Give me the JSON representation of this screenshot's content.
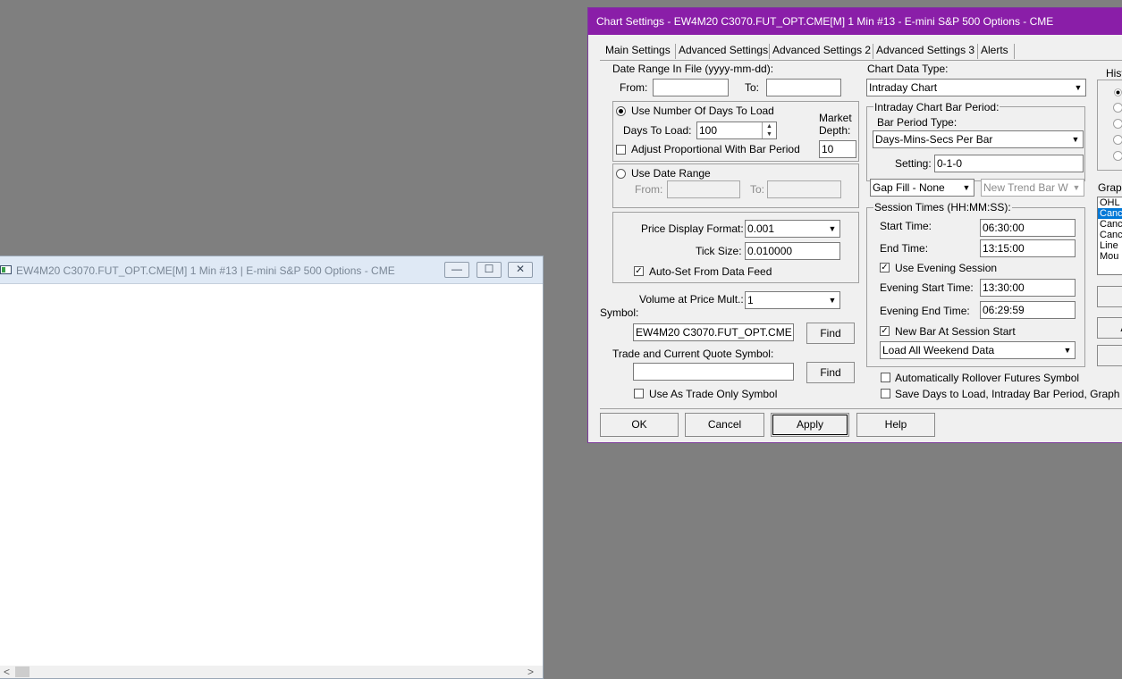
{
  "chart_window": {
    "title": "EW4M20 C3070.FUT_OPT.CME[M]  1 Min  #13 | E-mini S&P 500 Options - CME",
    "minimize": "—",
    "restore": "☐",
    "close": "✕",
    "scroll_left": "<",
    "scroll_right": ">"
  },
  "dialog": {
    "title": "Chart Settings - EW4M20 C3070.FUT_OPT.CME[M]  1 Min  #13 - E-mini S&P 500 Options - CME",
    "tabs": [
      "Main Settings",
      "Advanced Settings",
      "Advanced Settings 2",
      "Advanced Settings 3",
      "Alerts"
    ],
    "date_range_file": {
      "label": "Date Range In File (yyyy-mm-dd):",
      "from_label": "From:",
      "to_label": "To:",
      "from_value": "",
      "to_value": ""
    },
    "days_group": {
      "use_days_label": "Use Number Of Days To Load",
      "days_label": "Days To Load:",
      "days_value": "100",
      "adjust_label": "Adjust Proportional With Bar Period",
      "market_label_1": "Market",
      "market_label_2": "Depth:",
      "market_value": "10"
    },
    "date_range_group": {
      "use_label": "Use Date Range",
      "from_label": "From:",
      "to_label": "To:"
    },
    "price_group": {
      "price_format_label": "Price Display Format:",
      "price_format_value": "0.001",
      "tick_size_label": "Tick Size:",
      "tick_size_value": "0.010000",
      "auto_set_label": "Auto-Set From Data Feed"
    },
    "volume_label": "Volume at Price Mult.:",
    "volume_value": "1",
    "symbol_label": "Symbol:",
    "symbol_value": "EW4M20 C3070.FUT_OPT.CME",
    "find_label": "Find",
    "trade_symbol_label": "Trade and Current Quote Symbol:",
    "trade_symbol_value": "",
    "trade_only_label": "Use As Trade Only Symbol",
    "chart_data_type_label": "Chart Data Type:",
    "chart_data_type_value": "Intraday Chart",
    "bar_period": {
      "group_label": "Intraday Chart Bar Period:",
      "type_label": "Bar Period Type:",
      "type_value": "Days-Mins-Secs Per Bar",
      "setting_label": "Setting:",
      "setting_value": "0-1-0"
    },
    "gap_fill_value": "Gap Fill - None",
    "new_trend_value": "New Trend Bar W",
    "session": {
      "group_label": "Session Times (HH:MM:SS):",
      "start_label": "Start Time:",
      "start_value": "06:30:00",
      "end_label": "End Time:",
      "end_value": "13:15:00",
      "use_evening_label": "Use Evening Session",
      "evening_start_label": "Evening Start Time:",
      "evening_start_value": "13:30:00",
      "evening_end_label": "Evening End Time:",
      "evening_end_value": "06:29:59",
      "new_bar_label": "New Bar At Session Start",
      "weekend_value": "Load All Weekend Data"
    },
    "rollover_label": "Automatically Rollover Futures Symbol",
    "save_days_label": "Save Days to Load, Intraday Bar Period, Graph D",
    "hist_label": "Hist",
    "graph_label": "Grapl",
    "graph_list": [
      "OHL",
      "Canc",
      "Canc",
      "Canc",
      "Line",
      "Mou"
    ],
    "right_btn_1": "S",
    "right_btn_2": "Ap",
    "right_btn_3": "E",
    "ok_label": "OK",
    "cancel_label": "Cancel",
    "apply_label": "Apply",
    "help_label": "Help"
  }
}
